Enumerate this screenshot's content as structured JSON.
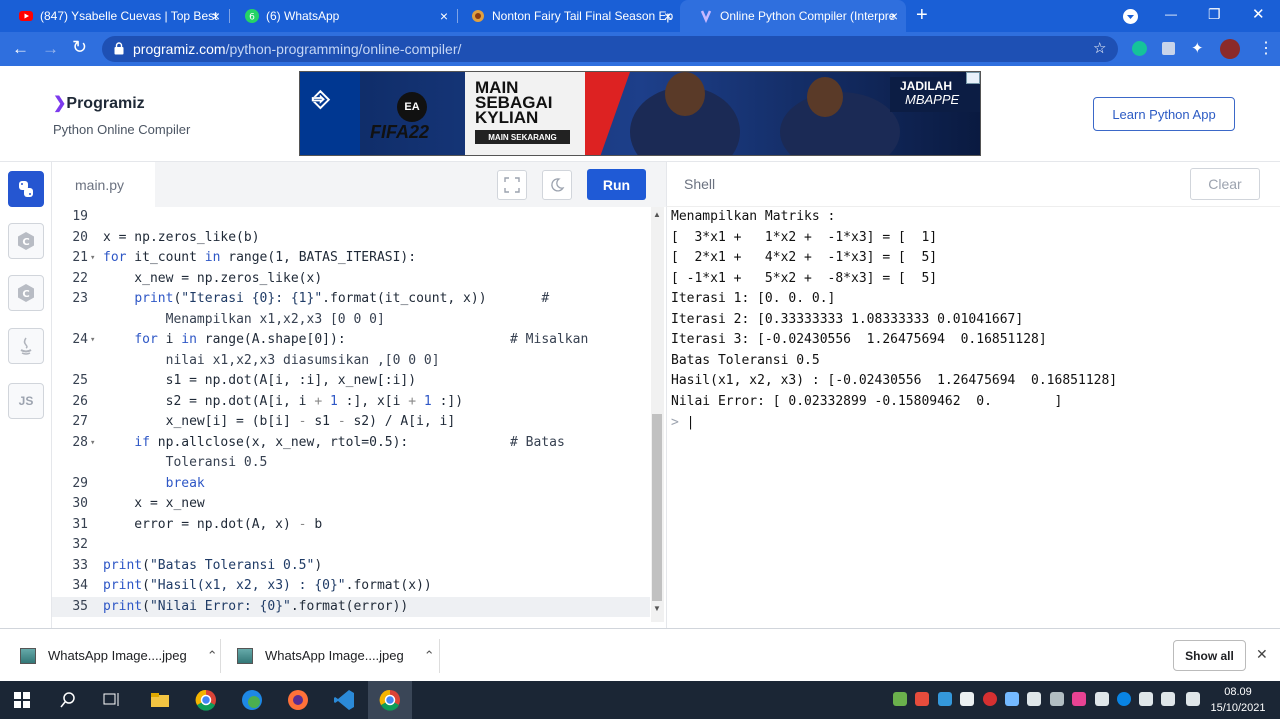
{
  "browser": {
    "tabs": [
      {
        "title": "(847) Ysabelle Cuevas | Top Best",
        "icon": "youtube-icon",
        "close": "×"
      },
      {
        "title": "(6) WhatsApp",
        "icon": "whatsapp-icon",
        "close": "×"
      },
      {
        "title": "Nonton Fairy Tail Final Season Ep",
        "icon": "site-icon",
        "close": "×"
      },
      {
        "title": "Online Python Compiler (Interpre",
        "icon": "programiz-icon",
        "close": "×",
        "active": true
      }
    ],
    "new_tab": "+",
    "window_controls": {
      "minimize": "—",
      "restore": "❐",
      "close": "✕"
    },
    "url_domain": "programiz.com",
    "url_path": "/python-programming/online-compiler/"
  },
  "header": {
    "logo": "Programiz",
    "subtitle": "Python Online Compiler",
    "learn_button": "Learn Python App",
    "ad": {
      "headline_1": "MAIN",
      "headline_2": "SEBAGAI",
      "headline_3": "KYLIAN",
      "cta": "MAIN SEKARANG",
      "game": "FIFA22",
      "tagline_1": "JADILAH",
      "tagline_2": "MBAPPE"
    }
  },
  "sidenav": {
    "items": [
      "python-icon",
      "c-icon",
      "cpp-icon",
      "java-icon",
      "JS"
    ]
  },
  "editor": {
    "filename": "main.py",
    "run_label": "Run"
  },
  "code_lines": [
    {
      "n": "19",
      "fold": "",
      "html": ""
    },
    {
      "n": "20",
      "fold": "",
      "html": "x = np.zeros_like(b)"
    },
    {
      "n": "21",
      "fold": "▾",
      "html": "<span class='kw'>for</span> it_count <span class='kw'>in</span> range(1, BATAS_ITERASI):"
    },
    {
      "n": "22",
      "fold": "",
      "html": "    x_new = np.zeros_like(x)"
    },
    {
      "n": "23",
      "fold": "",
      "html": "    <span class='kw'>print</span>(<span class='st'>\"Iterasi {0}: {1}\"</span>.format(it_count, x))       <span class='cm'>#</span>"
    },
    {
      "n": "",
      "fold": "",
      "html": "        <span class='cm'>Menampilkan x1,x2,x3 [0 0 0]</span>"
    },
    {
      "n": "24",
      "fold": "▾",
      "html": "    <span class='kw'>for</span> i <span class='kw'>in</span> range(A.shape[0]):                     <span class='cm'># Misalkan</span>"
    },
    {
      "n": "",
      "fold": "",
      "html": "        <span class='cm'>nilai x1,x2,x3 diasumsikan ,[0 0 0]</span>"
    },
    {
      "n": "25",
      "fold": "",
      "html": "        s1 = np.dot(A[i, :i], x_new[:i])"
    },
    {
      "n": "26",
      "fold": "",
      "html": "        s2 = np.dot(A[i, i <span class='op'>+</span> <span class='nm'>1</span> :], x[i <span class='op'>+</span> <span class='nm'>1</span> :])"
    },
    {
      "n": "27",
      "fold": "",
      "html": "        x_new[i] = (b[i] <span class='op'>-</span> s1 <span class='op'>-</span> s2) / A[i, i]"
    },
    {
      "n": "28",
      "fold": "▾",
      "html": "    <span class='kw'>if</span> np.allclose(x, x_new, rtol=0.5):             <span class='cm'># Batas</span>"
    },
    {
      "n": "",
      "fold": "",
      "html": "        <span class='cm'>Toleransi 0.5</span>"
    },
    {
      "n": "29",
      "fold": "",
      "html": "        <span class='kw'>break</span>"
    },
    {
      "n": "30",
      "fold": "",
      "html": "    x = x_new"
    },
    {
      "n": "31",
      "fold": "",
      "html": "    error = np.dot(A, x) <span class='op'>-</span> b"
    },
    {
      "n": "32",
      "fold": "",
      "html": ""
    },
    {
      "n": "33",
      "fold": "",
      "html": "<span class='kw'>print</span>(<span class='st'>\"Batas Toleransi 0.5\"</span>)"
    },
    {
      "n": "34",
      "fold": "",
      "html": "<span class='kw'>print</span>(<span class='st'>\"Hasil(x1, x2, x3) : {0}\"</span>.format(x))"
    },
    {
      "n": "35",
      "fold": "",
      "html": "<span class='kw'>print</span>(<span class='st'>\"Nilai Error: {0}\"</span>.format(error))",
      "active": true
    }
  ],
  "shell": {
    "title": "Shell",
    "clear_label": "Clear",
    "output": [
      "Menampilkan Matriks :",
      "[  3*x1 +   1*x2 +  -1*x3] = [  1]",
      "[  2*x1 +   4*x2 +  -1*x3] = [  5]",
      "[ -1*x1 +   5*x2 +  -8*x3] = [  5]",
      "Iterasi 1: [0. 0. 0.]",
      "Iterasi 2: [0.33333333 1.08333333 0.01041667]",
      "Iterasi 3: [-0.02430556  1.26475694  0.16851128]",
      "Batas Toleransi 0.5",
      "Hasil(x1, x2, x3) : [-0.02430556  1.26475694  0.16851128]",
      "Nilai Error: [ 0.02332899 -0.15809462  0.        ]"
    ],
    "prompt": ">"
  },
  "downloads": {
    "items": [
      {
        "name": "WhatsApp Image....jpeg",
        "chevron": "^"
      },
      {
        "name": "WhatsApp Image....jpeg",
        "chevron": "^"
      }
    ],
    "show_all": "Show all",
    "close": "✕"
  },
  "taskbar": {
    "time": "08.09",
    "date": "15/10/2021"
  },
  "colors": {
    "accent": "#1f5ad6",
    "chrome": "#2f6fde"
  }
}
